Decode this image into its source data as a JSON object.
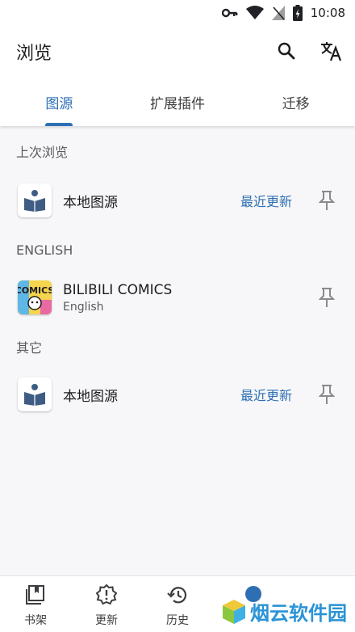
{
  "status_bar": {
    "time": "10:08"
  },
  "app_bar": {
    "title": "浏览",
    "icons": [
      "search-icon",
      "translate-icon"
    ]
  },
  "tabs": [
    {
      "label": "图源",
      "active": true
    },
    {
      "label": "扩展插件",
      "active": false
    },
    {
      "label": "迁移",
      "active": false
    }
  ],
  "sections": [
    {
      "header": "上次浏览",
      "items": [
        {
          "name": "本地图源",
          "action": "最近更新",
          "icon": "book-reader-icon"
        }
      ]
    },
    {
      "header": "ENGLISH",
      "items": [
        {
          "name": "BILIBILI COMICS",
          "subtitle": "English",
          "icon": "comics-icon"
        }
      ]
    },
    {
      "header": "其它",
      "items": [
        {
          "name": "本地图源",
          "action": "最近更新",
          "icon": "book-reader-icon"
        }
      ]
    }
  ],
  "bottom_nav": [
    {
      "label": "书架",
      "icon": "bookshelf-icon"
    },
    {
      "label": "更新",
      "icon": "update-alert-icon"
    },
    {
      "label": "历史",
      "icon": "history-icon"
    },
    {
      "label": "",
      "icon": "browse-icon",
      "active": true
    },
    {
      "label": "",
      "icon": "more-icon"
    }
  ],
  "watermark": {
    "text": "烟云软件园"
  },
  "colors": {
    "accent": "#2e6fb4",
    "background": "#f7f7f9"
  }
}
